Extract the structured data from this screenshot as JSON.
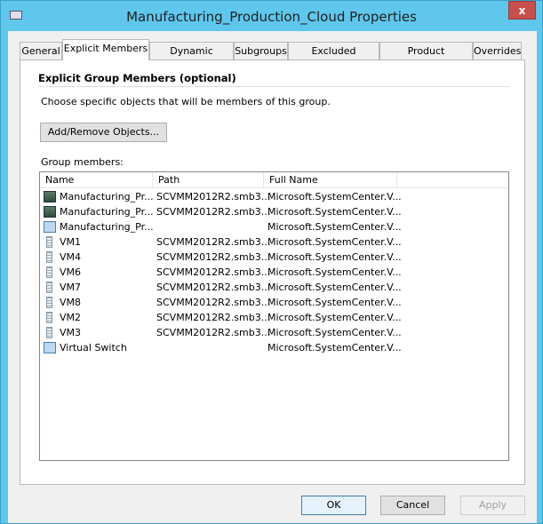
{
  "window": {
    "title": "Manufacturing_Production_Cloud Properties",
    "close": "x"
  },
  "tabs": [
    "General",
    "Explicit Members",
    "Dynamic Members",
    "Subgroups",
    "Excluded Members",
    "Product Knowledge",
    "Overrides"
  ],
  "active_tab": "Explicit Members",
  "panel": {
    "heading": "Explicit Group Members (optional)",
    "description": "Choose specific objects that will be members of this group.",
    "add_remove": "Add/Remove Objects...",
    "members_label": "Group members:"
  },
  "list": {
    "columns": [
      "Name",
      "Path",
      "Full Name"
    ],
    "rows": [
      {
        "icon": "server-icon",
        "name": "Manufacturing_Pr...",
        "path": "SCVMM2012R2.smb3...",
        "full": "Microsoft.SystemCenter.V..."
      },
      {
        "icon": "server-icon",
        "name": "Manufacturing_Pr...",
        "path": "SCVMM2012R2.smb3...",
        "full": "Microsoft.SystemCenter.V..."
      },
      {
        "icon": "switch-icon",
        "name": "Manufacturing_Pr...",
        "path": "",
        "full": "Microsoft.SystemCenter.V..."
      },
      {
        "icon": "vm-icon",
        "name": "VM1",
        "path": "SCVMM2012R2.smb3...",
        "full": "Microsoft.SystemCenter.V..."
      },
      {
        "icon": "vm-icon",
        "name": "VM4",
        "path": "SCVMM2012R2.smb3...",
        "full": "Microsoft.SystemCenter.V..."
      },
      {
        "icon": "vm-icon",
        "name": "VM6",
        "path": "SCVMM2012R2.smb3...",
        "full": "Microsoft.SystemCenter.V..."
      },
      {
        "icon": "vm-icon",
        "name": "VM7",
        "path": "SCVMM2012R2.smb3...",
        "full": "Microsoft.SystemCenter.V..."
      },
      {
        "icon": "vm-icon",
        "name": "VM8",
        "path": "SCVMM2012R2.smb3...",
        "full": "Microsoft.SystemCenter.V..."
      },
      {
        "icon": "vm-icon",
        "name": "VM2",
        "path": "SCVMM2012R2.smb3...",
        "full": "Microsoft.SystemCenter.V..."
      },
      {
        "icon": "vm-icon",
        "name": "VM3",
        "path": "SCVMM2012R2.smb3...",
        "full": "Microsoft.SystemCenter.V..."
      },
      {
        "icon": "switch-icon",
        "name": "Virtual Switch",
        "path": "",
        "full": "Microsoft.SystemCenter.V..."
      }
    ]
  },
  "buttons": {
    "ok": "OK",
    "cancel": "Cancel",
    "apply": "Apply"
  },
  "colors": {
    "titlebar": "#5fc6ec",
    "close": "#c7504a"
  }
}
